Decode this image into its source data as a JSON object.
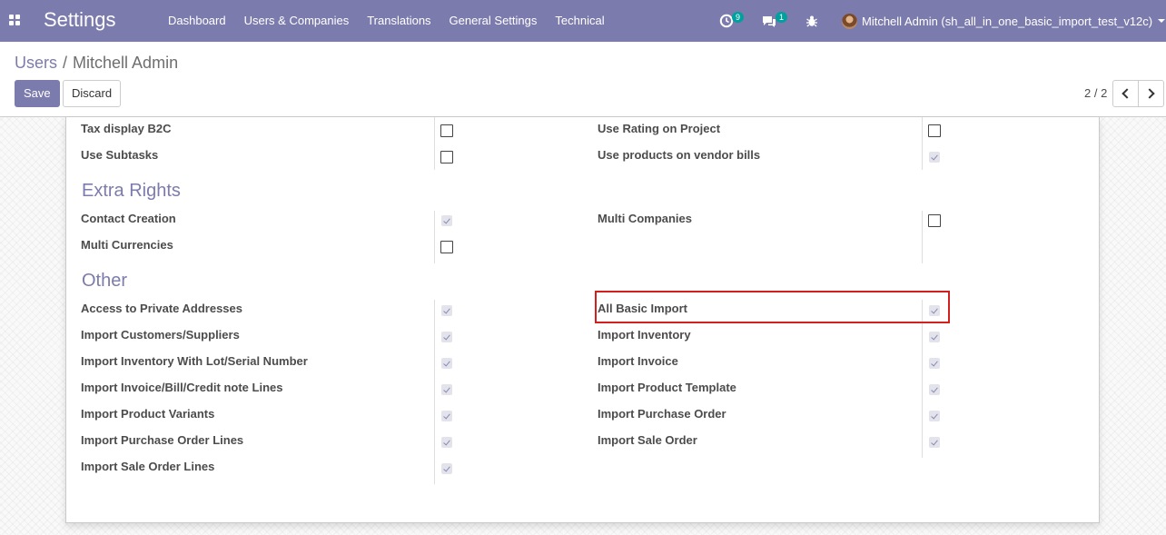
{
  "navbar": {
    "app_title": "Settings",
    "menu": [
      "Dashboard",
      "Users & Companies",
      "Translations",
      "General Settings",
      "Technical"
    ],
    "activity_count": "9",
    "messages_count": "1",
    "user_name": "Mitchell Admin (sh_all_in_one_basic_import_test_v12c)"
  },
  "breadcrumb": {
    "parent": "Users",
    "separator": "/",
    "current": "Mitchell Admin"
  },
  "actions": {
    "save": "Save",
    "discard": "Discard"
  },
  "pager": {
    "value": "2 / 2"
  },
  "top_fields": {
    "left": [
      {
        "label": "Tax display B2C",
        "checked": false
      },
      {
        "label": "Use Subtasks",
        "checked": false
      }
    ],
    "right": [
      {
        "label": "Use Rating on Project",
        "checked": false
      },
      {
        "label": "Use products on vendor bills",
        "checked": true
      }
    ]
  },
  "extra_rights": {
    "title": "Extra Rights",
    "left": [
      {
        "label": "Contact Creation",
        "checked": true
      },
      {
        "label": "Multi Currencies",
        "checked": false
      }
    ],
    "right": [
      {
        "label": "Multi Companies",
        "checked": false
      }
    ]
  },
  "other": {
    "title": "Other",
    "left": [
      {
        "label": "Access to Private Addresses",
        "checked": true
      },
      {
        "label": "Import Customers/Suppliers",
        "checked": true
      },
      {
        "label": "Import Inventory With Lot/Serial Number",
        "checked": true
      },
      {
        "label": "Import Invoice/Bill/Credit note Lines",
        "checked": true
      },
      {
        "label": "Import Product Variants",
        "checked": true
      },
      {
        "label": "Import Purchase Order Lines",
        "checked": true
      },
      {
        "label": "Import Sale Order Lines",
        "checked": true
      }
    ],
    "right": [
      {
        "label": "All Basic Import",
        "checked": true
      },
      {
        "label": "Import Inventory",
        "checked": true
      },
      {
        "label": "Import Invoice",
        "checked": true
      },
      {
        "label": "Import Product Template",
        "checked": true
      },
      {
        "label": "Import Purchase Order",
        "checked": true
      },
      {
        "label": "Import Sale Order",
        "checked": true
      }
    ]
  },
  "colors": {
    "brand": "#7c7bad",
    "badge": "#00a09d",
    "highlight": "#d41f1f"
  }
}
